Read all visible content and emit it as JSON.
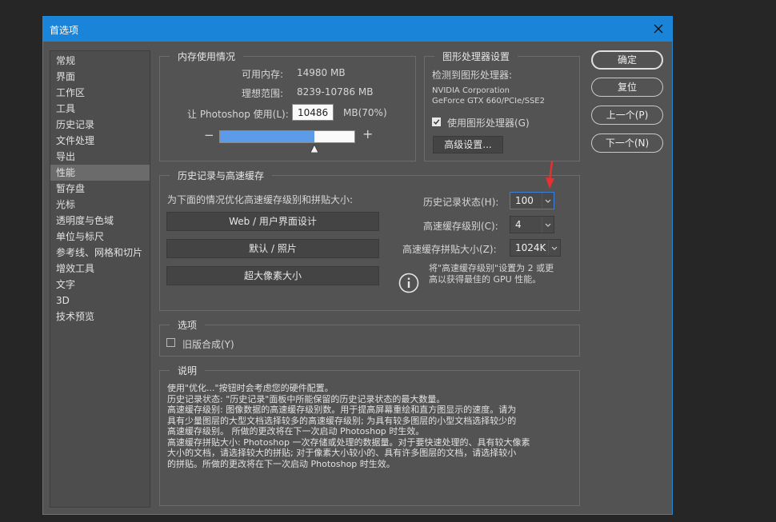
{
  "dialog": {
    "title": "首选项"
  },
  "sidebar": {
    "items": [
      {
        "label": "常规"
      },
      {
        "label": "界面"
      },
      {
        "label": "工作区"
      },
      {
        "label": "工具"
      },
      {
        "label": "历史记录"
      },
      {
        "label": "文件处理"
      },
      {
        "label": "导出"
      },
      {
        "label": "性能"
      },
      {
        "label": "暂存盘"
      },
      {
        "label": "光标"
      },
      {
        "label": "透明度与色域"
      },
      {
        "label": "单位与标尺"
      },
      {
        "label": "参考线、网格和切片"
      },
      {
        "label": "增效工具"
      },
      {
        "label": "文字"
      },
      {
        "label": "3D"
      },
      {
        "label": "技术预览"
      }
    ],
    "active_index": 7
  },
  "memory": {
    "title": "内存使用情况",
    "available_label": "可用内存:",
    "available_value": "14980 MB",
    "ideal_label": "理想范围:",
    "ideal_value": "8239-10786 MB",
    "let_label": "让 Photoshop 使用(L):",
    "let_value": "10486",
    "percent_label": "MB(70%)",
    "slider_fraction": 0.7,
    "minus": "−",
    "plus": "+"
  },
  "gpu": {
    "title": "图形处理器设置",
    "detected_label": "检测到图形处理器:",
    "vendor": "NVIDIA Corporation",
    "model": "GeForce GTX 660/PCIe/SSE2",
    "use_gpu_label": "使用图形处理器(G)",
    "use_gpu_checked": true,
    "advanced_button": "高级设置..."
  },
  "history_cache": {
    "title": "历史记录与高速缓存",
    "optimize_label": "为下面的情况优化高速缓存级别和拼贴大小:",
    "buttons": [
      "Web / 用户界面设计",
      "默认 / 照片",
      "超大像素大小"
    ],
    "history_states_label": "历史记录状态(H):",
    "history_states_value": "100",
    "cache_levels_label": "高速缓存级别(C):",
    "cache_levels_value": "4",
    "tile_size_label": "高速缓存拼贴大小(Z):",
    "tile_size_value": "1024K",
    "info_line1": "将\"高速缓存级别\"设置为 2 或更",
    "info_line2": "高以获得最佳的 GPU 性能。"
  },
  "options": {
    "title": "选项",
    "legacy_compositing_label": "旧版合成(Y)",
    "legacy_compositing_checked": false
  },
  "description": {
    "title": "说明",
    "lines": [
      "使用\"优化...\"按钮时会考虑您的硬件配置。",
      "历史记录状态: \"历史记录\"面板中所能保留的历史记录状态的最大数量。",
      "高速缓存级别: 图像数据的高速缓存级别数。用于提高屏幕重绘和直方图显示的速度。请为",
      "具有少量图层的大型文档选择较多的高速缓存级别; 为具有较多图层的小型文档选择较少的",
      "高速缓存级别。 所做的更改将在下一次启动 Photoshop 时生效。",
      "高速缓存拼贴大小: Photoshop 一次存储或处理的数据量。对于要快速处理的、具有较大像素",
      "大小的文档，请选择较大的拼贴; 对于像素大小较小的、具有许多图层的文档，请选择较小",
      "的拼贴。所做的更改将在下一次启动 Photoshop 时生效。"
    ]
  },
  "actions": {
    "ok": "确定",
    "reset": "复位",
    "prev": "上一个(P)",
    "next": "下一个(N)"
  },
  "colors": {
    "titlebar": "#1a84d9",
    "slider_fill": "#5b9be8",
    "annotation_arrow": "#e8312e"
  }
}
